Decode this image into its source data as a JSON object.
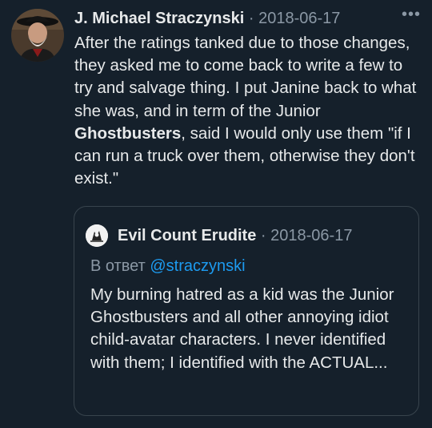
{
  "tweet": {
    "author_name": "J. Michael Straczynski",
    "separator": "·",
    "date": "2018-06-17",
    "more_icon": "more-dots-icon",
    "text_before_bold": "After the ratings tanked due to those changes, they asked me to come back to write a few to try and salvage thing.  I put Janine back to what she was, and in term of the Junior ",
    "text_bold": "Ghostbusters",
    "text_after_bold": ", said I would only use them \"if I can run a truck over them, otherwise they don't exist.\""
  },
  "quoted_tweet": {
    "author_name": "Evil Count Erudite",
    "separator": "·",
    "date": "2018-06-17",
    "reply_prefix": "В ответ",
    "reply_handle": "@straczynski",
    "text": "My burning hatred as a kid was the Junior Ghostbusters and all other annoying idiot child-avatar characters. I never identified with them; I identified with the ACTUAL..."
  },
  "colors": {
    "background": "#15202b",
    "text": "#e7e9ea",
    "secondary": "#8b98a5",
    "link": "#1d9bf0",
    "border": "#38444d"
  }
}
